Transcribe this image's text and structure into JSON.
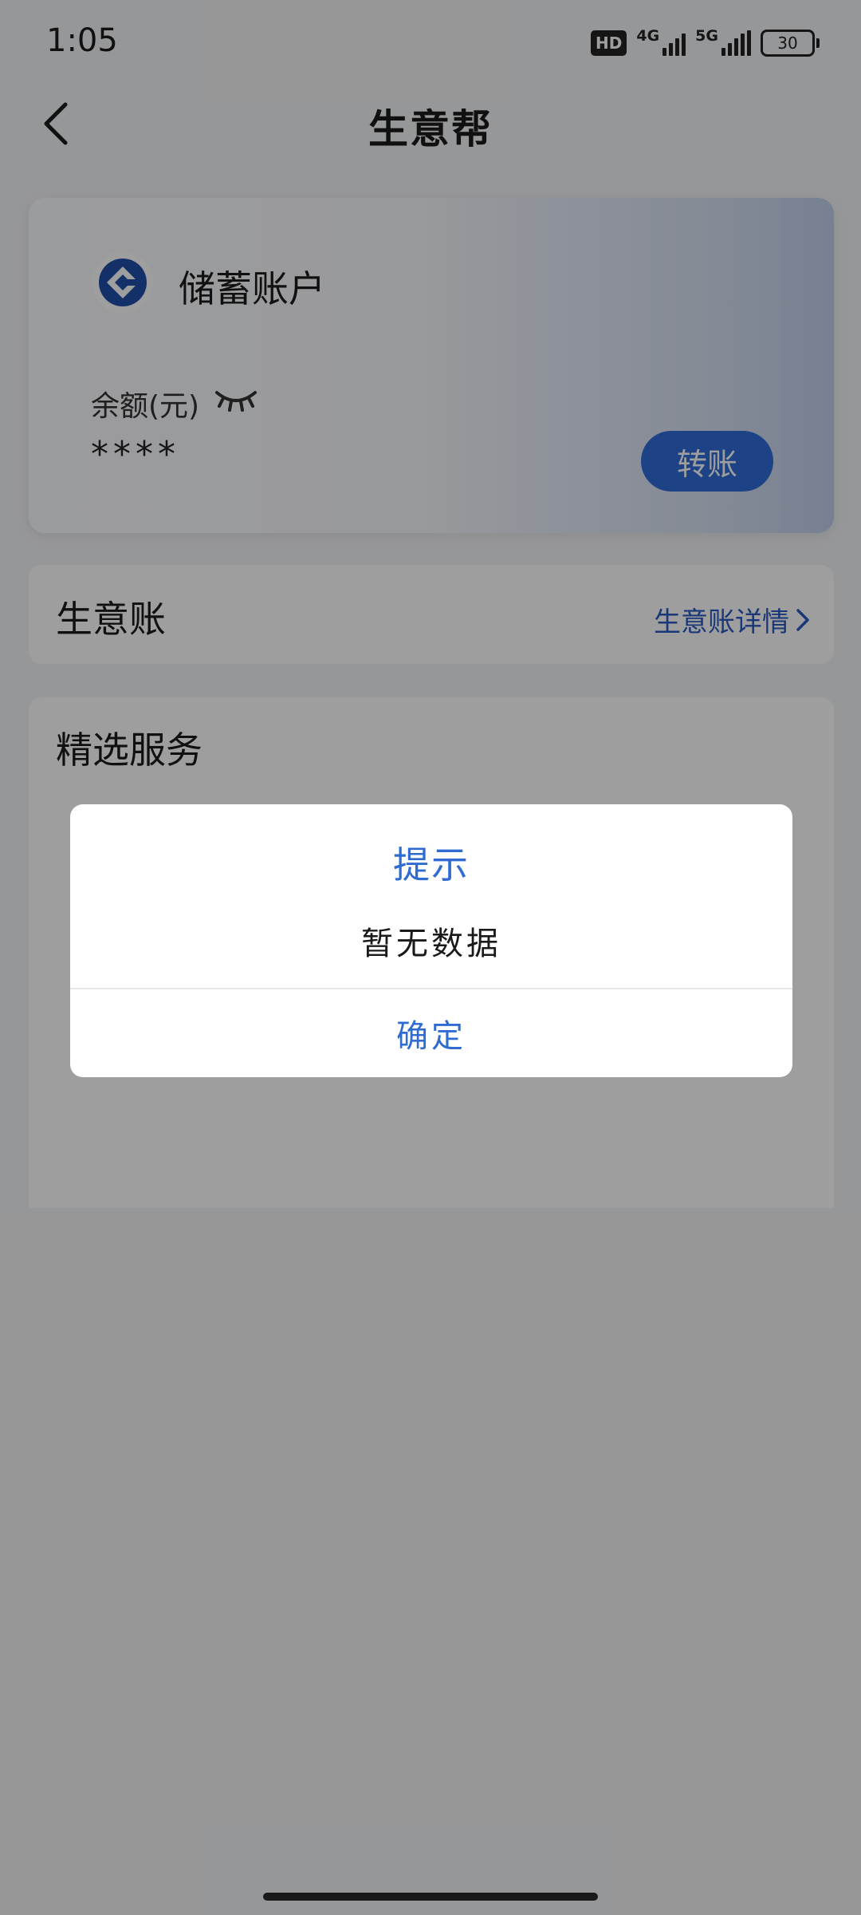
{
  "status_bar": {
    "time": "1:05",
    "hd_label": "HD",
    "net1_label": "4G",
    "net2_label": "5G",
    "battery_level": "30"
  },
  "nav": {
    "back_icon": "chevron-left-icon",
    "title": "生意帮"
  },
  "account_card": {
    "logo_icon": "bank-logo-icon",
    "account_type": "储蓄账户",
    "balance_label": "余额(元)",
    "visibility_icon": "eye-closed-icon",
    "balance_value": "****",
    "transfer_label": "转账"
  },
  "business": {
    "title": "生意账",
    "detail_link": "生意账详情",
    "detail_icon": "chevron-right-icon"
  },
  "services": {
    "title": "精选服务"
  },
  "dialog": {
    "title": "提示",
    "message": "暂无数据",
    "confirm_label": "确定"
  },
  "colors": {
    "accent": "#2f6bd1",
    "link": "#2a5bc2",
    "overlay": "rgba(0,0,0,0.38)"
  }
}
